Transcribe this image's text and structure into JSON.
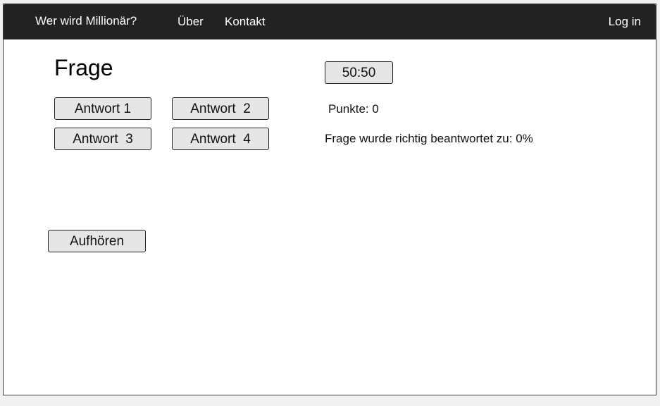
{
  "navbar": {
    "brand": "Wer wird Millionär?",
    "links": [
      {
        "label": "Über"
      },
      {
        "label": "Kontakt"
      }
    ],
    "login_label": "Log in"
  },
  "question": {
    "title": "Frage"
  },
  "answers": [
    {
      "label": "Antwort 1"
    },
    {
      "label": "Antwort  2"
    },
    {
      "label": "Antwort  3"
    },
    {
      "label": "Antwort  4"
    }
  ],
  "lifeline": {
    "fifty_fifty_label": "50:50"
  },
  "score": {
    "label": "Punkte:",
    "value": "0"
  },
  "stats": {
    "label": "Frage wurde richtig beantwortet zu:",
    "value": "0%"
  },
  "quit_label": "Aufhören"
}
